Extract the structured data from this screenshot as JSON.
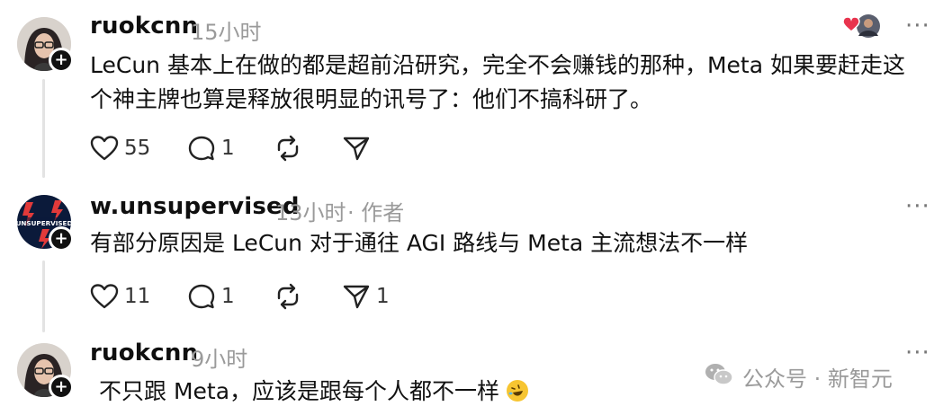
{
  "posts": [
    {
      "username": "ruokcnn",
      "time": "15小时",
      "author_tag": "",
      "text_lines": [
        "LeCun 基本上在做的都是超前沿研究，完全不会赚钱的那种，Meta 如果要赶走这",
        "个神主牌也算是释放很明显的讯号了：他们不搞科研了。"
      ],
      "likes": "55",
      "replies": "1",
      "reposts": "",
      "shares": ""
    },
    {
      "username": "w.unsupervised",
      "time": "13小时",
      "author_tag": "· 作者",
      "avatar_text": "UNSUPERVISED",
      "text_lines": [
        "有部分原因是 LeCun 对于通往 AGI 路线与 Meta 主流想法不一样"
      ],
      "likes": "11",
      "replies": "1",
      "reposts": "",
      "shares": "1"
    },
    {
      "username": "ruokcnn",
      "time": "9小时",
      "author_tag": "",
      "text_lines": [
        "不只跟 Meta，应该是跟每个人都不一样"
      ],
      "emoji": "rolling-on-floor-laughing-emoji"
    }
  ],
  "more_label": "···",
  "follow_symbol": "+",
  "watermark": "公众号 · 新智元",
  "colors": {
    "muted": "#9a9a9a",
    "thread_line": "#e3e3e3",
    "heart": "#e8344e",
    "avatar2_bg": "#0b1a3a",
    "avatar2_bolt": "#e23a3a"
  }
}
